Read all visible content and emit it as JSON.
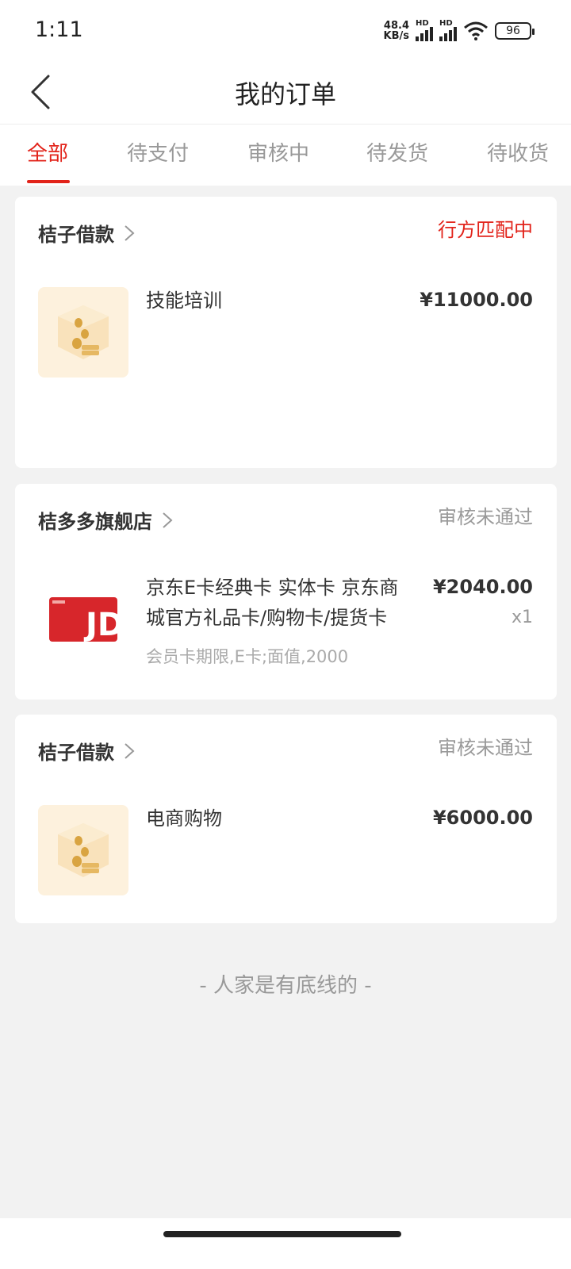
{
  "status_bar": {
    "time": "1:11",
    "net_speed_value": "48.4",
    "net_speed_unit": "KB/s",
    "signal_badge": "HD",
    "battery": "96"
  },
  "nav": {
    "title": "我的订单"
  },
  "tabs": [
    {
      "label": "全部",
      "active": true
    },
    {
      "label": "待支付"
    },
    {
      "label": "审核中"
    },
    {
      "label": "待发货"
    },
    {
      "label": "待收货"
    }
  ],
  "orders": [
    {
      "shop": "桔子借款",
      "status": "行方匹配中",
      "status_color": "#e2231a",
      "product_name": "技能培训",
      "price": "¥11000.00"
    },
    {
      "shop": "桔多多旗舰店",
      "status": "审核未通过",
      "product_name_line1": "京东E卡经典卡 实体卡 京东商",
      "product_name_line2": "城官方礼品卡/购物卡/提货卡",
      "spec": "会员卡期限,E卡;面值,2000",
      "price": "¥2040.00",
      "qty": "x1",
      "card_brand": "JD"
    },
    {
      "shop": "桔子借款",
      "status": "审核未通过",
      "product_name": "电商购物",
      "price": "¥6000.00"
    }
  ],
  "footer_note": "- 人家是有底线的 -",
  "colors": {
    "accent": "#e2231a",
    "background": "#f2f2f2"
  }
}
